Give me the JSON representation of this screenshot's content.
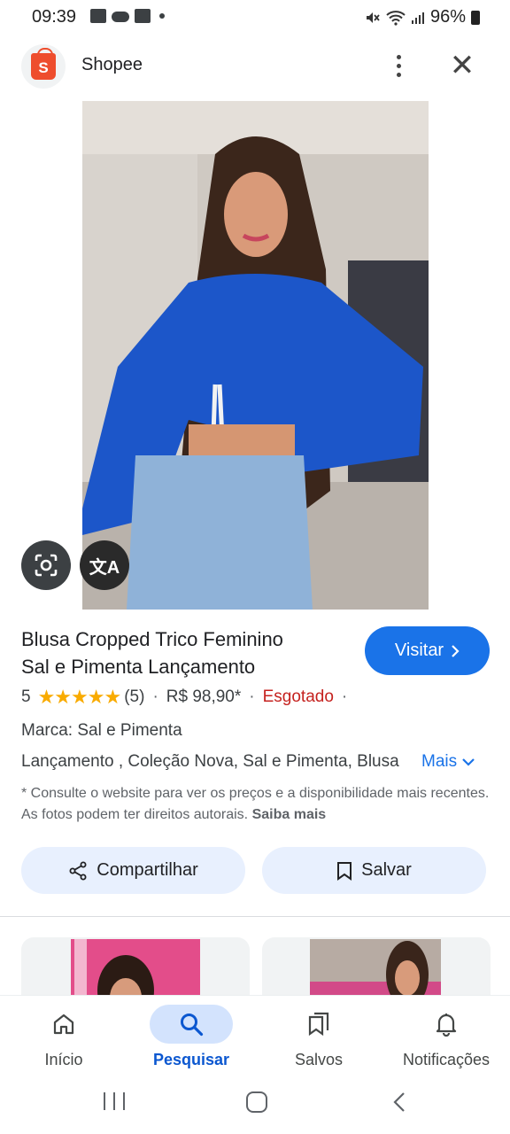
{
  "status_bar": {
    "time": "09:39",
    "battery": "96%"
  },
  "source": {
    "name": "Shopee",
    "logo_letter": "S",
    "brand_color": "#ee4d2d"
  },
  "product": {
    "title_line1": "Blusa Cropped Trico Feminino",
    "title_line2": "Sal e Pimenta Lançamento",
    "visit_label": "Visitar",
    "rating_value": "5",
    "stars": "★★★★★",
    "review_count": "(5)",
    "price": "R$ 98,90*",
    "availability": "Esgotado",
    "brand_line": "Marca: Sal e Pimenta",
    "tags_line": "Lançamento , Coleção Nova, Sal e Pimenta, Blusa",
    "more_label": "Mais",
    "disclaimer": "* Consulte o website para ver os preços e a disponibilidade mais recentes. As fotos podem ter direitos autorais.",
    "disclaimer_link": "Saiba mais"
  },
  "actions": {
    "share_label": "Compartilhar",
    "save_label": "Salvar"
  },
  "bottom_nav": {
    "items": [
      {
        "label": "Início",
        "icon": "home-icon"
      },
      {
        "label": "Pesquisar",
        "icon": "search-icon",
        "active": true
      },
      {
        "label": "Salvos",
        "icon": "bookmarks-icon"
      },
      {
        "label": "Notificações",
        "icon": "bell-icon"
      }
    ]
  },
  "colors": {
    "accent": "#1a73e8",
    "out_of_stock": "#c5221f",
    "star": "#f9ab00",
    "action_bg": "#e8f0fe"
  }
}
